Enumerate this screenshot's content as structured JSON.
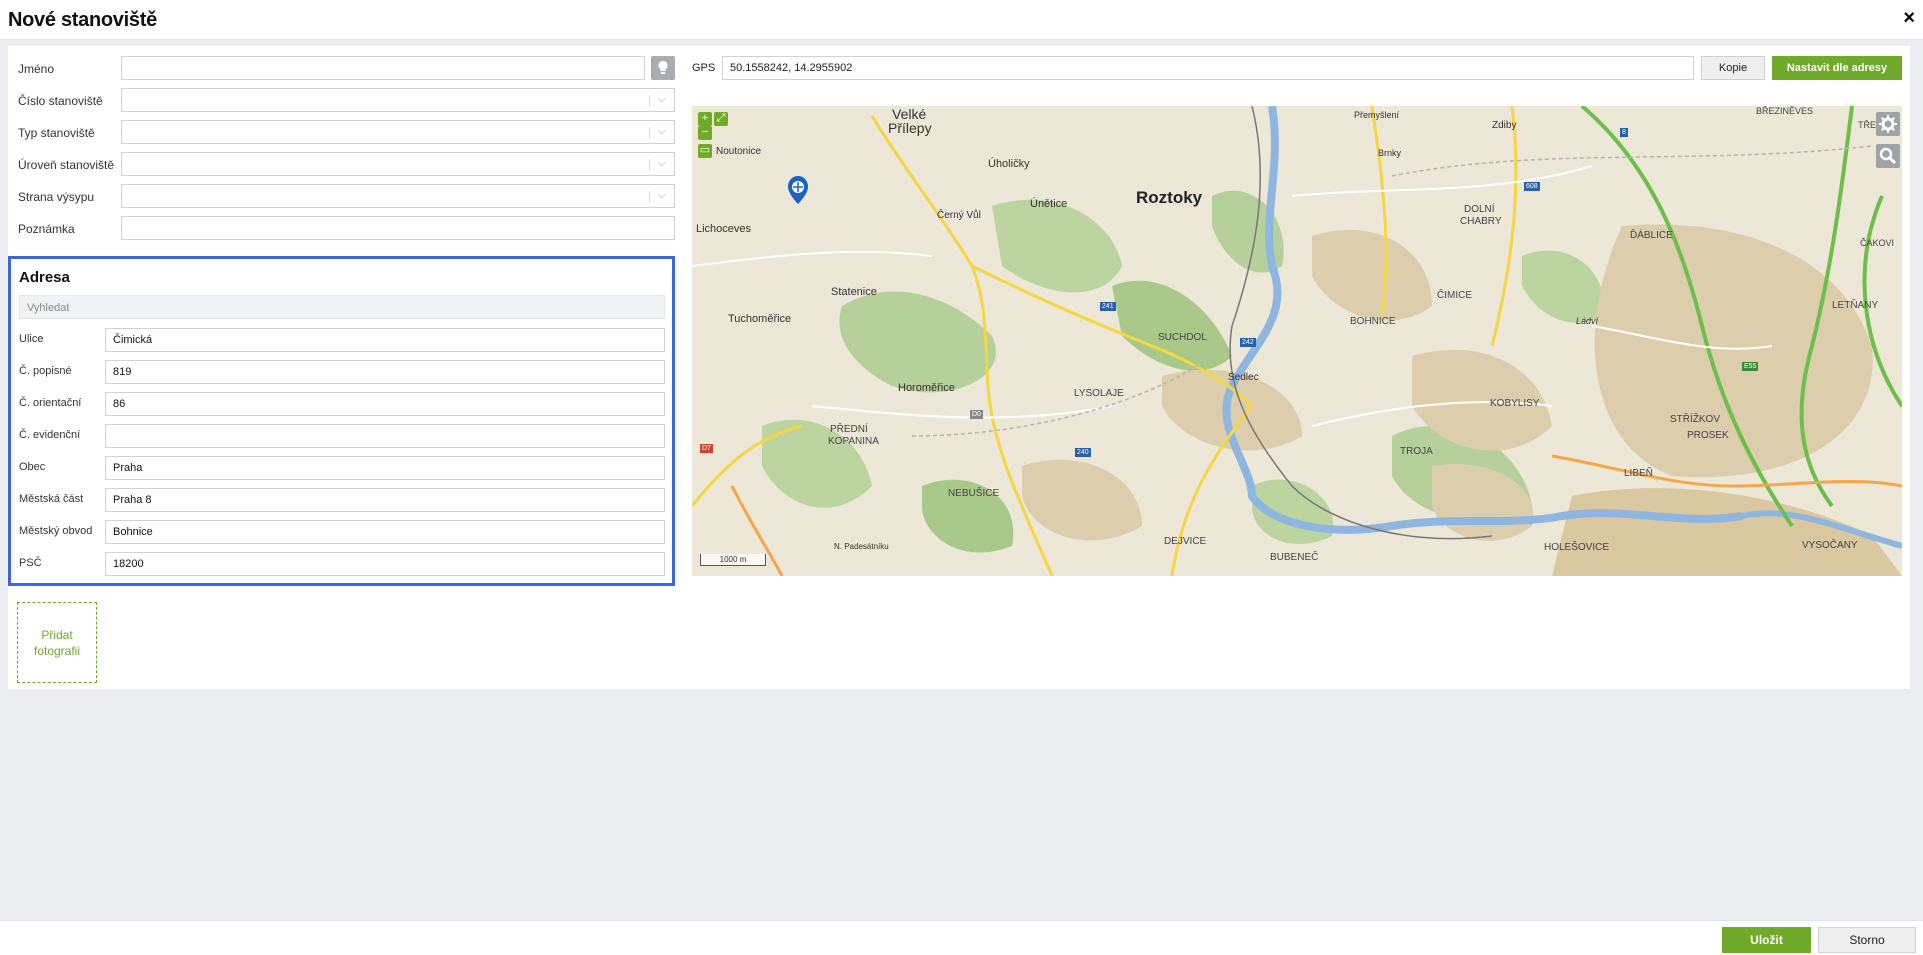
{
  "dialog": {
    "title": "Nové stanoviště",
    "close_label": "×"
  },
  "form": {
    "rows": [
      {
        "label": "Jméno",
        "value": "",
        "type": "text"
      },
      {
        "label": "Číslo stanoviště",
        "value": "",
        "type": "select"
      },
      {
        "label": "Typ stanoviště",
        "value": "",
        "type": "select"
      },
      {
        "label": "Úroveň stanoviště",
        "value": "",
        "type": "select"
      },
      {
        "label": "Strana výsypu",
        "value": "",
        "type": "select"
      },
      {
        "label": "Poznámka",
        "value": "",
        "type": "text"
      }
    ]
  },
  "address": {
    "title": "Adresa",
    "search_placeholder": "Vyhledat",
    "fields": [
      {
        "label": "Ulice",
        "value": "Čimická"
      },
      {
        "label": "Č. popisné",
        "value": "819"
      },
      {
        "label": "Č. orientační",
        "value": "86"
      },
      {
        "label": "Č. evidenční",
        "value": ""
      },
      {
        "label": "Obec",
        "value": "Praha"
      },
      {
        "label": "Městská část",
        "value": "Praha 8"
      },
      {
        "label": "Městský obvod",
        "value": "Bohnice"
      },
      {
        "label": "PSČ",
        "value": "18200"
      }
    ]
  },
  "photo": {
    "label": "Přidat fotografii"
  },
  "gps": {
    "label": "GPS",
    "value": "50.1558242, 14.2955902",
    "copy_label": "Kopie",
    "set_from_address_label": "Nastavit dle adresy"
  },
  "map": {
    "scale_label": "1000 m",
    "places": {
      "roztoky": "Roztoky",
      "velke_prilepy_1": "Velké",
      "velke_prilepy_2": "Přílepy",
      "noutonice": "Noutonice",
      "uholicky": "Úholičky",
      "unetice": "Únětice",
      "cerny_vul": "Černý Vůl",
      "lichoceves": "Lichoceves",
      "statenice": "Statenice",
      "tuchomerice": "Tuchoměřice",
      "horomerice": "Horoměřice",
      "lysolaje": "LYSOLAJE",
      "suchdol": "SUCHDOL",
      "sedlec": "Sedlec",
      "bohnice": "BOHNICE",
      "cimice": "ČIMICE",
      "dolni_chabry_1": "DOLNÍ",
      "dolni_chabry_2": "CHABRY",
      "dablice": "ĎÁBLICE",
      "letnany": "LETŇANY",
      "kobylisy": "KOBYLISY",
      "troja": "TROJA",
      "strizkov": "STŘÍŽKOV",
      "prosek": "PROSEK",
      "liben": "LIBEŇ",
      "holesovice": "HOLEŠOVICE",
      "vysocany": "VYSOČANY",
      "nebusice": "NEBUŠICE",
      "dejvice": "DEJVICE",
      "bubenec": "BUBENEČ",
      "predni_kopanina_1": "PŘEDNÍ",
      "predni_kopanina_2": "KOPANINA",
      "zdiby": "Zdiby",
      "premyslení": "Přemyšlení",
      "brnky": "Brnky",
      "brezineves": "BŘEZINĚVES",
      "trebo": "TŘEBO",
      "cakovi": "ČAKOVI",
      "ladvi": "Ládví",
      "na_padesatniku": "N. Padesátníku"
    },
    "roads": [
      "241",
      "240",
      "242",
      "608",
      "D0",
      "D7",
      "E55",
      "8"
    ],
    "colors": {
      "water": "#8fb6e0",
      "forest": "#a8c98a",
      "urban": "#d8c9a6",
      "road_major": "#f4d742",
      "highway": "#6dbf4b"
    }
  },
  "footer": {
    "save_label": "Uložit",
    "cancel_label": "Storno"
  }
}
